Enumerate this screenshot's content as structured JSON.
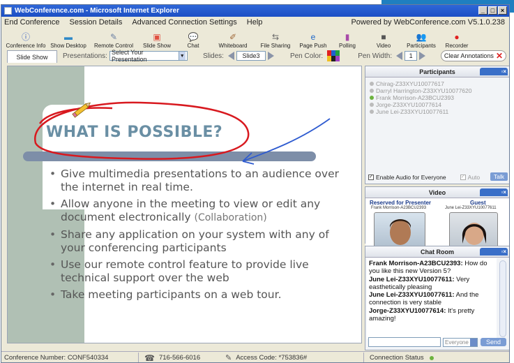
{
  "window": {
    "title": "WebConference.com - Microsoft Internet Explorer"
  },
  "menu": {
    "items": [
      "End Conference",
      "Session Details",
      "Advanced Connection Settings",
      "Help"
    ],
    "powered_by": "Powered by WebConference.com  V5.1.0.238"
  },
  "toolbar": {
    "tools": [
      {
        "label": "Conference Info",
        "icon": "info-icon",
        "glyph": "ⓘ",
        "color": "#3b63c4"
      },
      {
        "label": "Show Desktop",
        "icon": "monitor-icon",
        "glyph": "▬",
        "color": "#2f89c8"
      },
      {
        "label": "Remote Control",
        "icon": "remote-control-icon",
        "glyph": "✎",
        "color": "#6a7fa3"
      },
      {
        "label": "Slide Show",
        "icon": "slideshow-icon",
        "glyph": "▣",
        "color": "#e05040"
      },
      {
        "label": "Chat",
        "icon": "chat-icon",
        "glyph": "💬",
        "color": "#778"
      },
      {
        "label": "Whiteboard",
        "icon": "whiteboard-icon",
        "glyph": "✐",
        "color": "#a06a3a"
      },
      {
        "label": "File Sharing",
        "icon": "file-sharing-icon",
        "glyph": "⇆",
        "color": "#6a6a6a"
      },
      {
        "label": "Page Push",
        "icon": "page-push-icon",
        "glyph": "e",
        "color": "#1c66c8"
      },
      {
        "label": "Polling",
        "icon": "polling-icon",
        "glyph": "▮",
        "color": "#a84aa8"
      },
      {
        "label": "Video",
        "icon": "video-camera-icon",
        "glyph": "■",
        "color": "#555"
      },
      {
        "label": "Participants",
        "icon": "participants-icon",
        "glyph": "👥",
        "color": "#555"
      },
      {
        "label": "Recorder",
        "icon": "record-icon",
        "glyph": "●",
        "color": "#e02020"
      }
    ]
  },
  "controls": {
    "tab_label": "Slide Show",
    "presentations_label": "Presentations:",
    "presentations_value": "Select Your Presentation",
    "slides_label": "Slides:",
    "slide_value": "Slide3",
    "pen_color_label": "Pen Color:",
    "pen_width_label": "Pen Width:",
    "pen_width_value": "1",
    "clear_label": "Clear Annotations"
  },
  "slide": {
    "title": "WHAT IS POSSIBLE?",
    "bullets": [
      {
        "text": "Give multimedia presentations to an audience over the internet in real time.",
        "note": ""
      },
      {
        "text": "Allow anyone in the meeting to view or edit any document electronically",
        "note": "(Collaboration)"
      },
      {
        "text": "Share any application on your system with any of your conferencing participants",
        "note": ""
      },
      {
        "text": "Use our remote control feature to provide live technical support over the web",
        "note": ""
      },
      {
        "text": "Take meeting participants on a web tour.",
        "note": ""
      }
    ]
  },
  "participants": {
    "title": "Participants",
    "list": [
      {
        "name": "Chirag-Z33XYU10077617",
        "active": false
      },
      {
        "name": "Darryl Harrington-Z33XYU10077620",
        "active": false
      },
      {
        "name": "Frank Morrison-A23BCU2393",
        "active": true
      },
      {
        "name": "Jorge-Z33XYU10077614",
        "active": false
      },
      {
        "name": "June Lei-Z33XYU10077611",
        "active": false
      }
    ],
    "enable_audio_label": "Enable Audio for Everyone",
    "auto_label": "Auto",
    "talk_label": "Talk"
  },
  "video": {
    "title": "Video",
    "presenter_heading": "Reserved for Presenter",
    "presenter_name": "Frank Morrison-A23BCU2393",
    "guest_heading": "Guest",
    "guest_name": "June Lei-Z33XYU10077611"
  },
  "chat": {
    "title": "Chat Room",
    "messages": [
      {
        "sender": "Frank Morrison-A23BCU2393:",
        "text": "How do you like this new Version 5?"
      },
      {
        "sender": "June Lei-Z33XYU10077611:",
        "text": "Very easthetically pleasing"
      },
      {
        "sender": "June Lei-Z33XYU10077611:",
        "text": "And the connection is very stable"
      },
      {
        "sender": "Jorge-Z33XYU10077614:",
        "text": "It's pretty amazing!"
      }
    ],
    "recipient": "Everyone",
    "send_label": "Send"
  },
  "status": {
    "conference_number": "Conference Number: CONF540334",
    "phone": "716-566-6016",
    "access_code": "Access Code: *753836#",
    "connection_status": "Connection Status"
  },
  "colors": {
    "titlebar": "#1c4fc4",
    "accent": "#1f7fc0",
    "annotation_red": "#d8191f",
    "annotation_blue": "#2e5bd0",
    "slide_title": "#6a8fa4",
    "status_ok": "#6db33f"
  }
}
